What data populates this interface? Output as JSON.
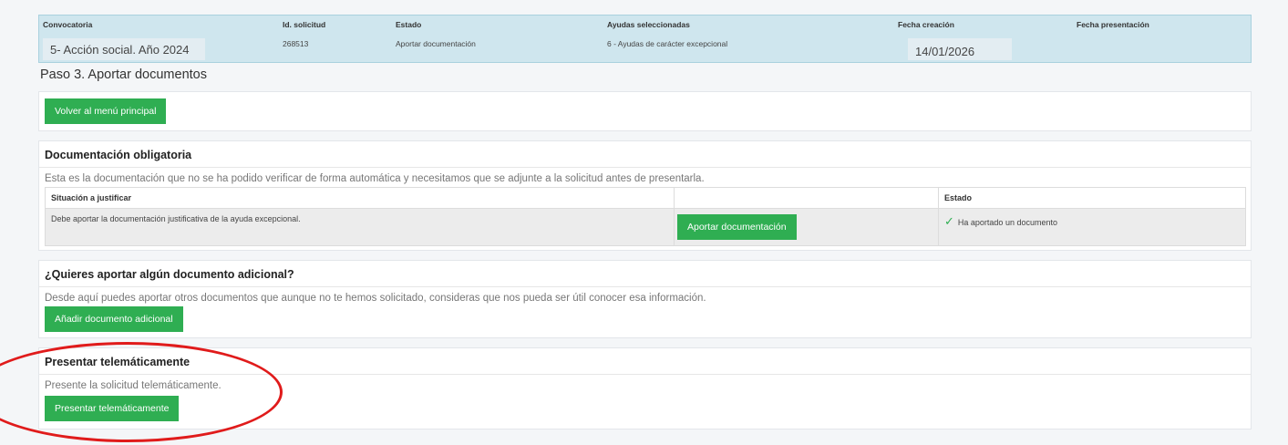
{
  "summary": {
    "headers": {
      "convocatoria": "Convocatoria",
      "id": "Id. solicitud",
      "estado": "Estado",
      "ayudas": "Ayudas seleccionadas",
      "fecha_creacion": "Fecha creación",
      "fecha_presentacion": "Fecha presentación"
    },
    "values": {
      "convocatoria": "5- Acción social. Año 2024",
      "id": "268513",
      "estado": "Aportar documentación",
      "ayudas": "6 - Ayudas de carácter excepcional",
      "fecha_creacion": "14/01/2026",
      "fecha_presentacion": ""
    }
  },
  "step_title": "Paso 3. Aportar documentos",
  "back_button": "Volver al menú principal",
  "obligatoria": {
    "title": "Documentación obligatoria",
    "description": "Esta es la documentación que no se ha podido verificar de forma automática y necesitamos que se adjunte a la solicitud antes de presentarla.",
    "columns": [
      "Situación a justificar",
      "",
      "Estado"
    ],
    "row": {
      "situacion": "Debe aportar la documentación justificativa de la ayuda excepcional.",
      "button": "Aportar documentación",
      "estado": "Ha aportado un documento"
    }
  },
  "adicional": {
    "title": "¿Quieres aportar algún documento adicional?",
    "description": "Desde aquí puedes aportar otros documentos que aunque no te hemos solicitado, consideras que nos pueda ser útil conocer esa información.",
    "button": "Añadir documento adicional"
  },
  "presentar": {
    "title": "Presentar telemáticamente",
    "description": "Presente la solicitud telemáticamente.",
    "button": "Presentar telemáticamente"
  },
  "colors": {
    "accent_green": "#2fae52",
    "summary_bg": "#cfe6ee",
    "annotation_red": "#e01b1b"
  },
  "icons": {
    "status_check": "check-icon"
  }
}
